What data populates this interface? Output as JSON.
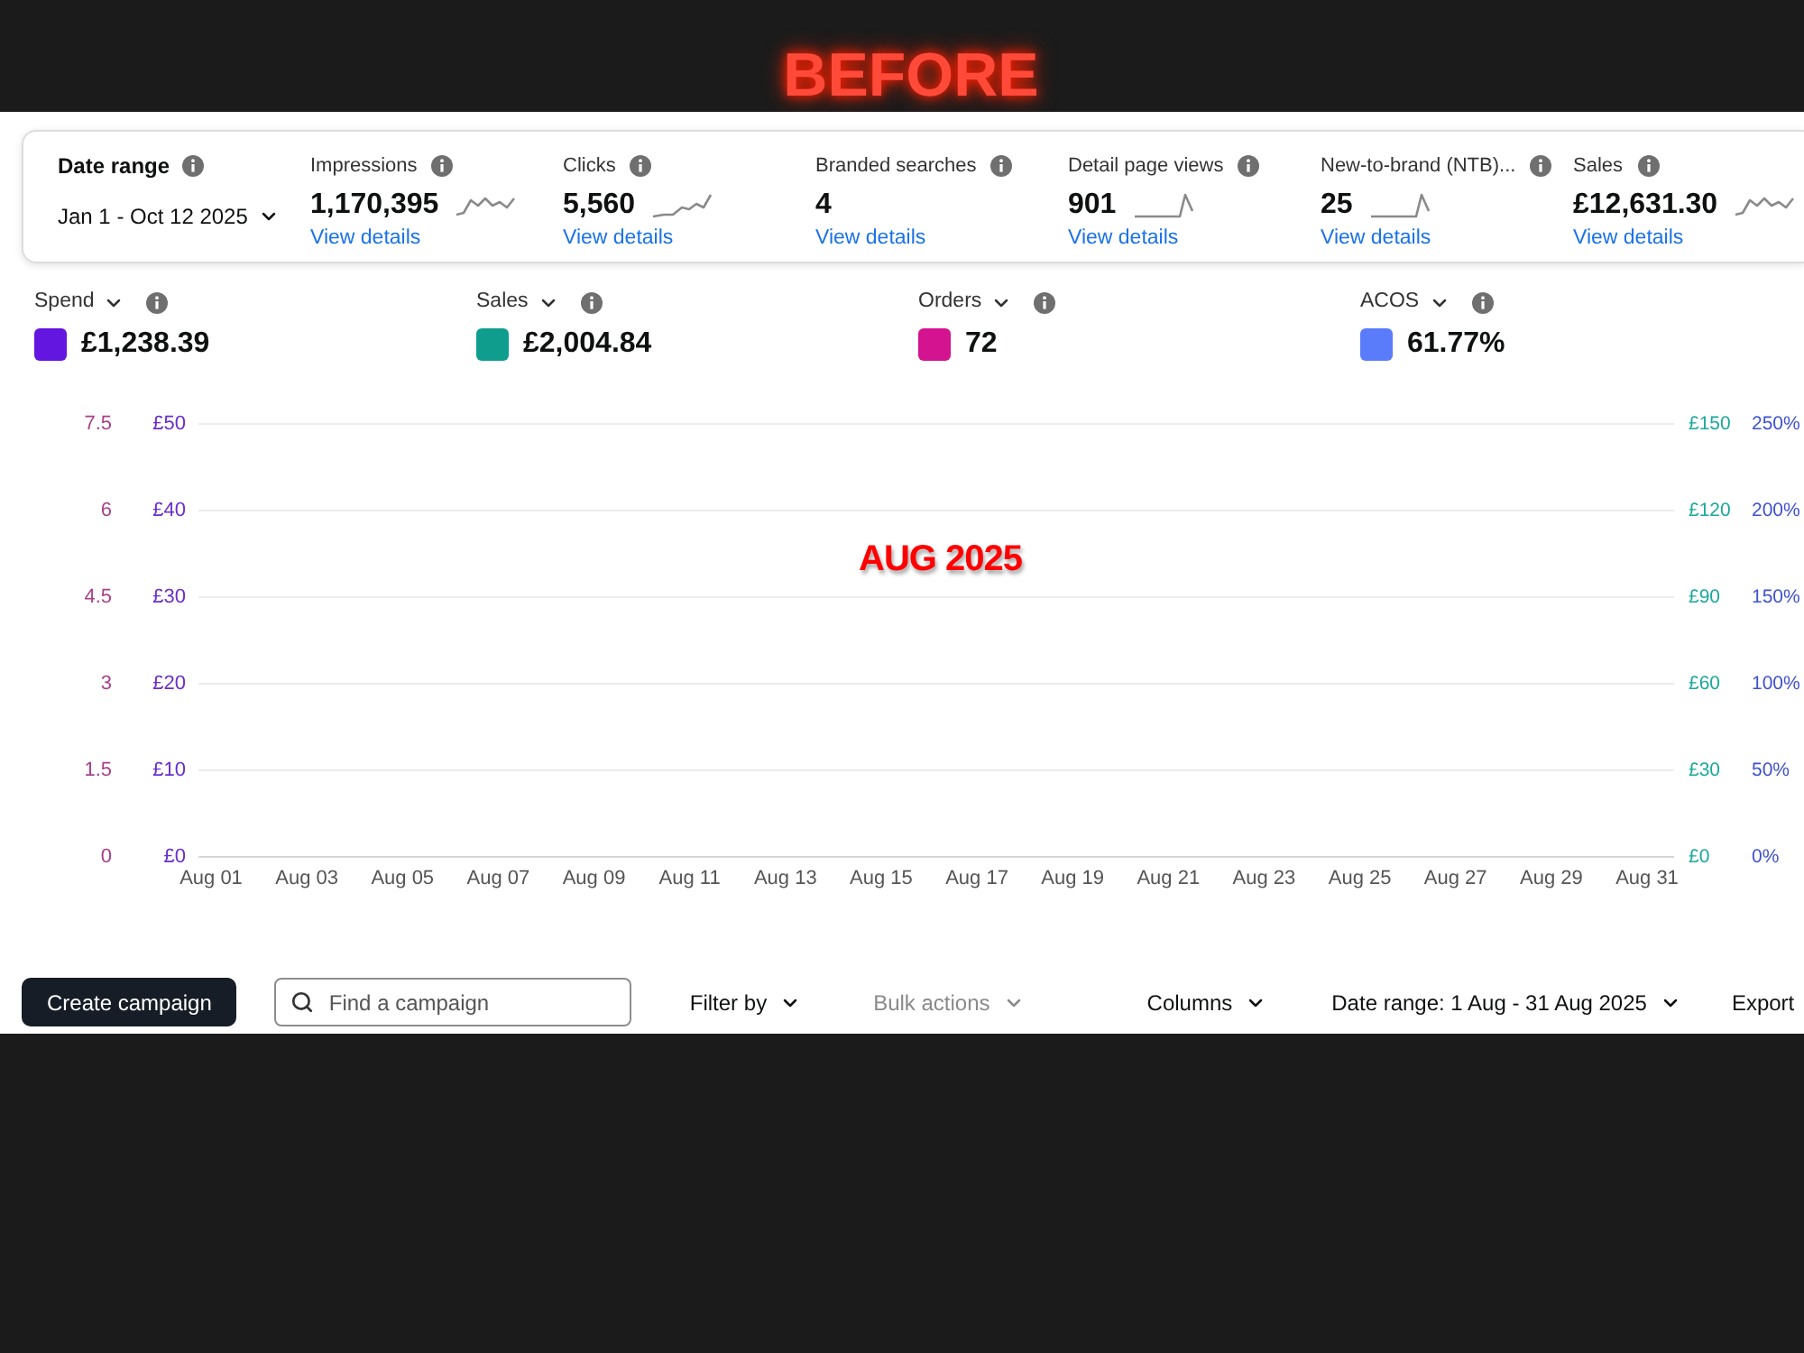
{
  "banner": {
    "caption": "BEFORE"
  },
  "summary": {
    "date_range": {
      "label": "Date range",
      "value": "Jan 1 - Oct 12 2025"
    },
    "metrics": [
      {
        "label": "Impressions",
        "value": "1,170,395",
        "link": "View details",
        "kind": "wavy"
      },
      {
        "label": "Clicks",
        "value": "5,560",
        "link": "View details",
        "kind": "rising"
      },
      {
        "label": "Branded searches",
        "value": "4",
        "link": "View details",
        "kind": "none"
      },
      {
        "label": "Detail page views",
        "value": "901",
        "link": "View details",
        "kind": "spike"
      },
      {
        "label": "New-to-brand (NTB)...",
        "value": "25",
        "link": "View details",
        "kind": "spike"
      },
      {
        "label": "Sales",
        "value": "£12,631.30",
        "link": "View details",
        "kind": "wavy"
      }
    ]
  },
  "legend": [
    {
      "label": "Spend",
      "value": "£1,238.39",
      "color": "#6316e0"
    },
    {
      "label": "Sales",
      "value": "£2,004.84",
      "color": "#0f9e8e"
    },
    {
      "label": "Orders",
      "value": "72",
      "color": "#d3138f"
    },
    {
      "label": "ACOS",
      "value": "61.77%",
      "color": "#5b7cfa"
    }
  ],
  "chart": {
    "overlay": "AUG 2025",
    "left_axes": [
      {
        "color": "#a8418a",
        "ticks": [
          "7.5",
          "6",
          "4.5",
          "3",
          "1.5",
          "0"
        ]
      },
      {
        "color": "#6a2fd0",
        "ticks": [
          "£50",
          "£40",
          "£30",
          "£20",
          "£10",
          "£0"
        ]
      }
    ],
    "right_axes": [
      {
        "color": "#1aa99b",
        "ticks": [
          "£150",
          "£120",
          "£90",
          "£60",
          "£30",
          "£0"
        ]
      },
      {
        "color": "#3f51d0",
        "ticks": [
          "250%",
          "200%",
          "150%",
          "100%",
          "50%",
          "0%"
        ]
      }
    ],
    "x_labels": [
      "Aug 01",
      "Aug 03",
      "Aug 05",
      "Aug 07",
      "Aug 09",
      "Aug 11",
      "Aug 13",
      "Aug 15",
      "Aug 17",
      "Aug 19",
      "Aug 21",
      "Aug 23",
      "Aug 25",
      "Aug 27",
      "Aug 29",
      "Aug 31"
    ]
  },
  "toolbar": {
    "create_button": "Create campaign",
    "search": {
      "placeholder": "Find a campaign"
    },
    "actions": [
      {
        "label": "Filter by",
        "disabled": false
      },
      {
        "label": "Bulk actions",
        "disabled": true
      },
      {
        "label": "Columns",
        "disabled": false
      },
      {
        "label": "Date range: 1 Aug - 31 Aug 2025",
        "disabled": false
      }
    ],
    "export": "Export"
  }
}
